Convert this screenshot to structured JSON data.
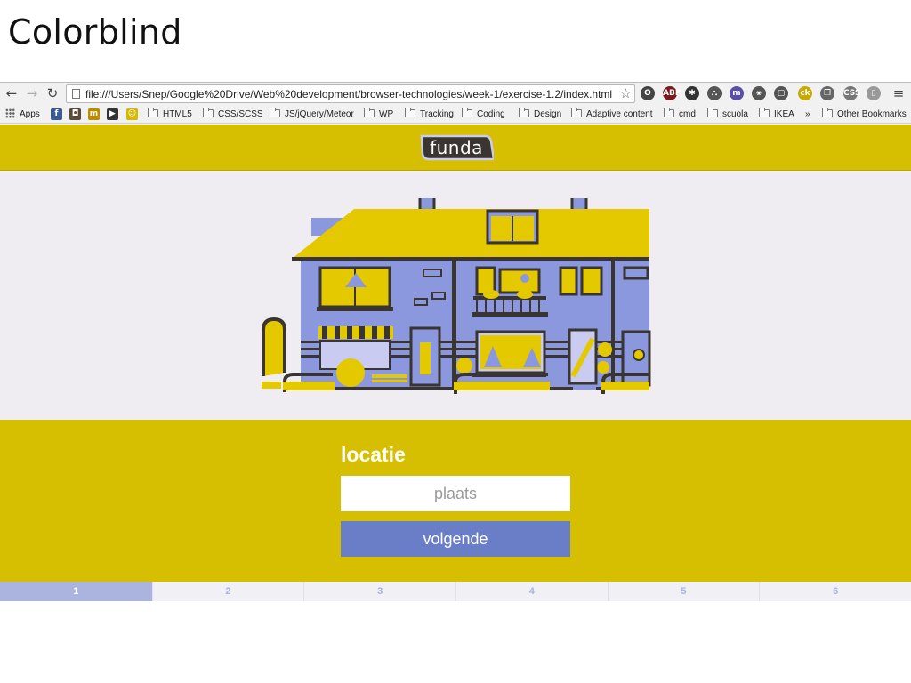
{
  "slide": {
    "title": "Colorblind"
  },
  "browser": {
    "url": "file:///Users/Snep/Google%20Drive/Web%20development/browser-technologies/week-1/exercise-1.2/index.html...",
    "back_icon": "arrow-left-icon",
    "forward_icon": "arrow-right-icon",
    "reload_icon": "reload-icon",
    "star_icon": "star-icon",
    "menu_icon": "hamburger-icon",
    "extensions": [
      {
        "name": "opera-icon",
        "label": "O",
        "color": "#444444"
      },
      {
        "name": "adblock-icon",
        "label": "ABP",
        "color": "#7a1a1a"
      },
      {
        "name": "gear-icon",
        "label": "✱",
        "color": "#333333"
      },
      {
        "name": "ghost-icon",
        "label": "⛬",
        "color": "#555555"
      },
      {
        "name": "m-extension-icon",
        "label": "m",
        "color": "#5a4fa8"
      },
      {
        "name": "network-icon",
        "label": "⚹",
        "color": "#555555"
      },
      {
        "name": "screen-capture-icon",
        "label": "▢",
        "color": "#555555"
      },
      {
        "name": "ck-icon",
        "label": "ck",
        "color": "#c9a800"
      },
      {
        "name": "layers-icon",
        "label": "❐",
        "color": "#666666"
      },
      {
        "name": "css-icon",
        "label": "CSS",
        "color": "#777777"
      },
      {
        "name": "page-icon",
        "label": "▯",
        "color": "#999999"
      }
    ],
    "bookmarks": [
      {
        "name": "bookmark-apps",
        "label": "Apps",
        "type": "apps"
      },
      {
        "name": "bookmark-facebook",
        "label": "",
        "type": "icon",
        "icon": "facebook-icon",
        "color": "#3b5998",
        "glyph": "f"
      },
      {
        "name": "bookmark-instagram",
        "label": "",
        "type": "icon",
        "icon": "instagram-icon",
        "color": "#5a4a3a",
        "glyph": "◘"
      },
      {
        "name": "bookmark-tn",
        "label": "",
        "type": "icon",
        "icon": "tn-icon",
        "color": "#c08a00",
        "glyph": "m"
      },
      {
        "name": "bookmark-youtube",
        "label": "",
        "type": "icon",
        "icon": "youtube-icon",
        "color": "#333333",
        "glyph": "▶"
      },
      {
        "name": "bookmark-smiley",
        "label": "",
        "type": "icon",
        "icon": "smiley-icon",
        "color": "#d6b800",
        "glyph": "☺"
      },
      {
        "name": "bookmark-html5",
        "label": "HTML5",
        "type": "folder"
      },
      {
        "name": "bookmark-css-scss",
        "label": "CSS/SCSS",
        "type": "folder"
      },
      {
        "name": "bookmark-js",
        "label": "JS/jQuery/Meteor",
        "type": "folder"
      },
      {
        "name": "bookmark-wp",
        "label": "WP",
        "type": "folder"
      },
      {
        "name": "bookmark-tracking",
        "label": "Tracking",
        "type": "folder"
      },
      {
        "name": "bookmark-coding",
        "label": "Coding",
        "type": "folder"
      },
      {
        "name": "bookmark-design",
        "label": "Design",
        "type": "folder"
      },
      {
        "name": "bookmark-adaptive",
        "label": "Adaptive content",
        "type": "folder"
      },
      {
        "name": "bookmark-cmd",
        "label": "cmd",
        "type": "folder"
      },
      {
        "name": "bookmark-scuola",
        "label": "scuola",
        "type": "folder"
      },
      {
        "name": "bookmark-ikea",
        "label": "IKEA",
        "type": "folder"
      },
      {
        "name": "bookmark-overflow",
        "label": "»",
        "type": "text"
      },
      {
        "name": "bookmark-other",
        "label": "Other Bookmarks",
        "type": "folder"
      }
    ]
  },
  "page": {
    "logo_text": "funda",
    "form": {
      "label": "locatie",
      "placeholder": "plaats",
      "button_label": "volgende"
    },
    "steps": [
      "1",
      "2",
      "3",
      "4",
      "5",
      "6"
    ],
    "active_step": "1"
  },
  "colors": {
    "header_bg": "#d6bf00",
    "hero_bg": "#efedf2",
    "button_bg": "#6a7ec8",
    "house_blue": "#8b98dd",
    "house_yellow": "#e5c900",
    "active_step_bg": "#abb4de"
  }
}
